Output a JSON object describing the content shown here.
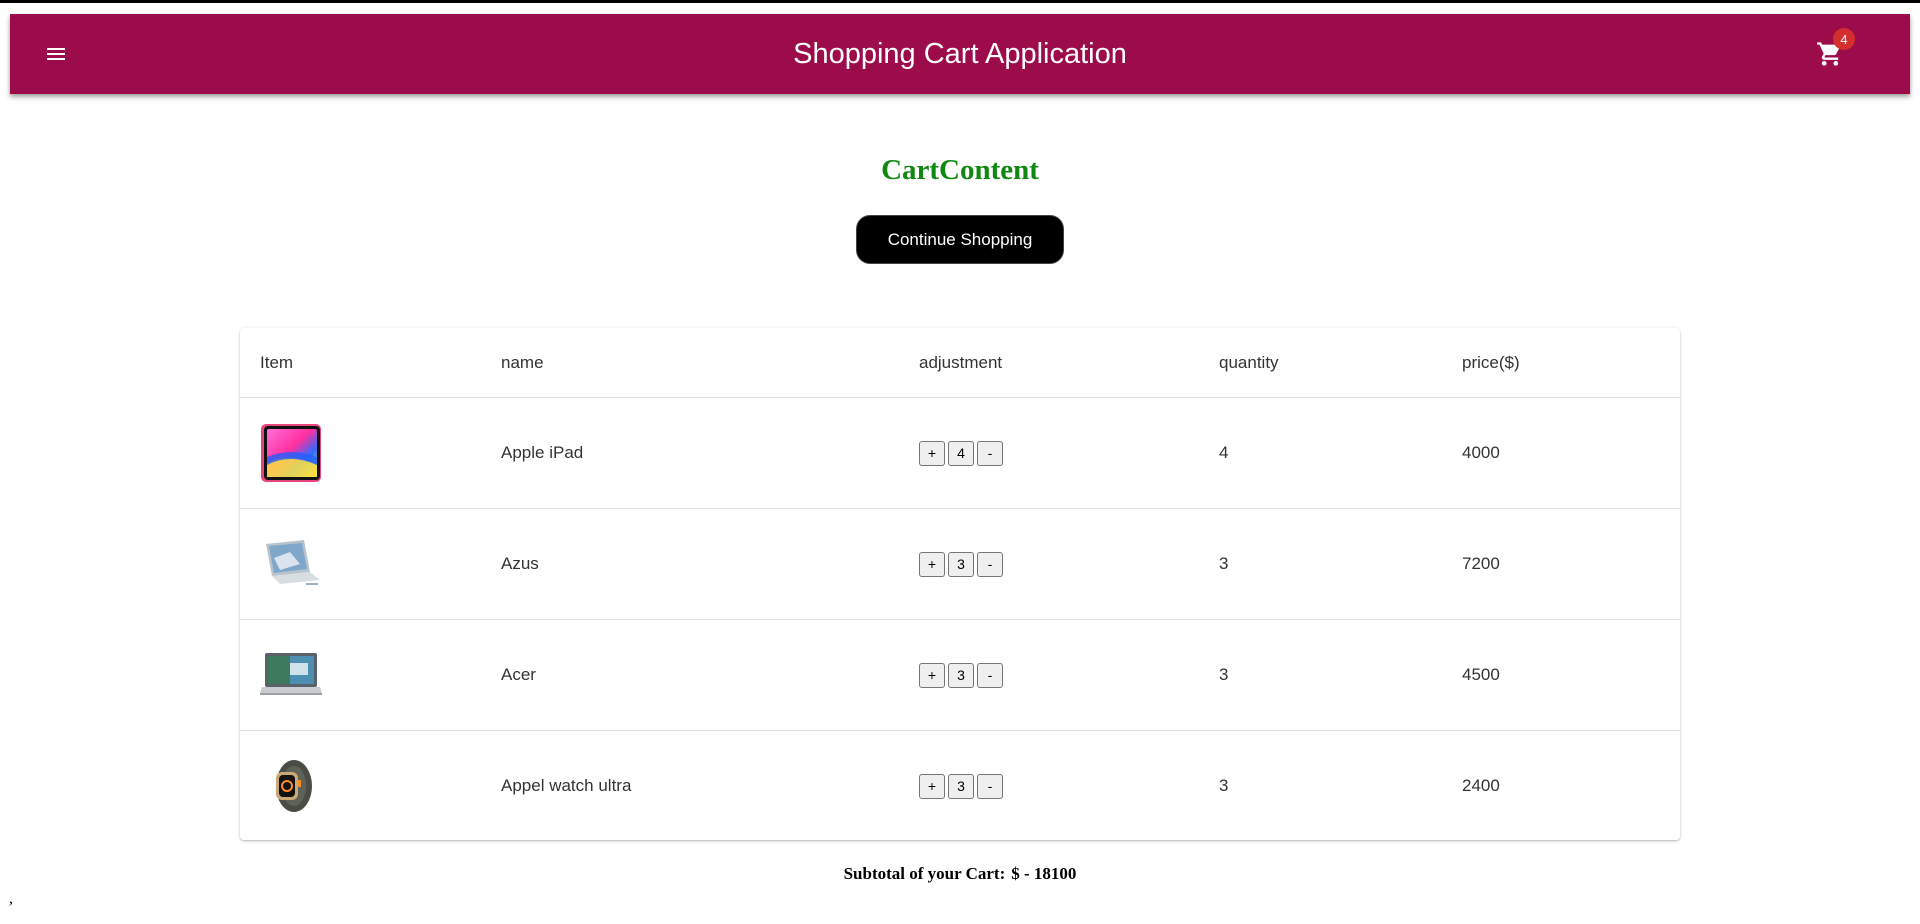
{
  "appbar": {
    "title": "Shopping Cart Application",
    "cart_count": "4",
    "menu_icon": "menu-icon",
    "cart_icon": "shopping-cart-icon",
    "color": "#9c0c4a"
  },
  "page": {
    "heading": "CartContent",
    "heading_color": "#118811",
    "continue_label": "Continue Shopping"
  },
  "table": {
    "headers": {
      "item": "Item",
      "name": "name",
      "adjustment": "adjustment",
      "quantity": "quantity",
      "price": "price($)"
    },
    "rows": [
      {
        "name": "Apple iPad",
        "adj_value": "4",
        "quantity": "4",
        "price": "4000",
        "plus": "+",
        "minus": "-",
        "image": "ipad-image"
      },
      {
        "name": "Azus",
        "adj_value": "3",
        "quantity": "3",
        "price": "7200",
        "plus": "+",
        "minus": "-",
        "image": "laptop-image"
      },
      {
        "name": "Acer",
        "adj_value": "3",
        "quantity": "3",
        "price": "4500",
        "plus": "+",
        "minus": "-",
        "image": "laptop-image"
      },
      {
        "name": "Appel watch ultra",
        "adj_value": "3",
        "quantity": "3",
        "price": "2400",
        "plus": "+",
        "minus": "-",
        "image": "watch-image"
      }
    ]
  },
  "subtotal": {
    "label": "Subtotal of your Cart:",
    "value": "$ - 18100"
  },
  "stray_text": ","
}
